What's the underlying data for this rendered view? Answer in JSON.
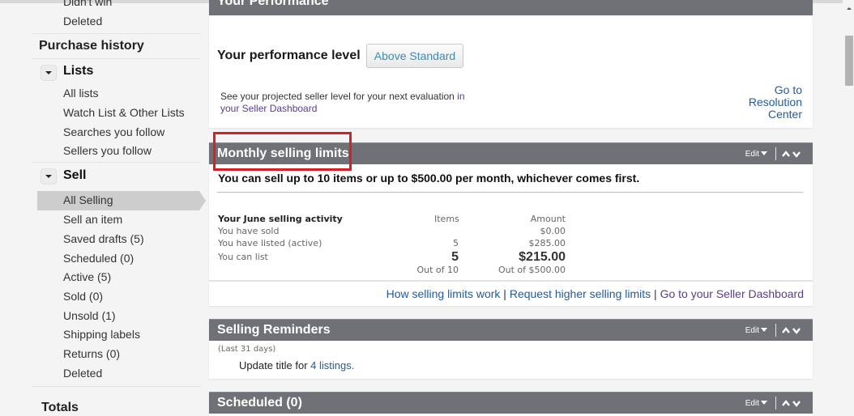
{
  "sidebar": {
    "cut_off_item": "Didn't win",
    "deleted_top": "Deleted",
    "purchase_history": "Purchase history",
    "lists": {
      "title": "Lists",
      "items": [
        "All lists",
        "Watch List & Other Lists",
        "Searches you follow",
        "Sellers you follow"
      ]
    },
    "sell": {
      "title": "Sell",
      "active_item": "All Selling",
      "items": [
        "All Selling",
        "Sell an item",
        "Saved drafts (5)",
        "Scheduled (0)",
        "Active (5)",
        "Sold (0)",
        "Unsold (1)",
        "Shipping labels",
        "Returns (0)",
        "Deleted"
      ]
    },
    "totals": "Totals"
  },
  "performance": {
    "header": "Your Performance",
    "level_label": "Your performance level",
    "level_value": "Above Standard",
    "projected_text": "See your projected seller level for your next evaluation",
    "projected_link": "in your Seller Dashboard",
    "resolution_link": [
      "Go to",
      "Resolution",
      "Center"
    ]
  },
  "limits": {
    "header": "Monthly selling limits",
    "edit_label": "Edit",
    "summary": "You can sell up to 10 items or up to $500.00 per month, whichever comes first.",
    "table": {
      "title": "Your June selling activity",
      "col_items": "Items",
      "col_amount": "Amount",
      "rows": [
        {
          "label": "You have sold",
          "items": "",
          "amount": "$0.00"
        },
        {
          "label": "You have listed (active)",
          "items": "5",
          "amount": "$285.00"
        },
        {
          "label": "You can list",
          "items": "5",
          "amount": "$215.00"
        }
      ],
      "items_out_of": "Out of 10",
      "amount_out_of": "Out of $500.00"
    },
    "links": [
      "How selling limits work",
      "Request higher selling limits",
      "Go to your Seller Dashboard"
    ],
    "separator": "|"
  },
  "reminders": {
    "header": "Selling Reminders",
    "edit_label": "Edit",
    "period": "(Last 31 days)",
    "text": "Update title for",
    "link": "4 listings."
  },
  "scheduled": {
    "header": "Scheduled (0)",
    "edit_label": "Edit"
  },
  "colors": {
    "panel_header": "#6f7177",
    "link": "#1f5c9e",
    "visited_link": "#5a3d8a",
    "highlight_box": "#d62027"
  }
}
